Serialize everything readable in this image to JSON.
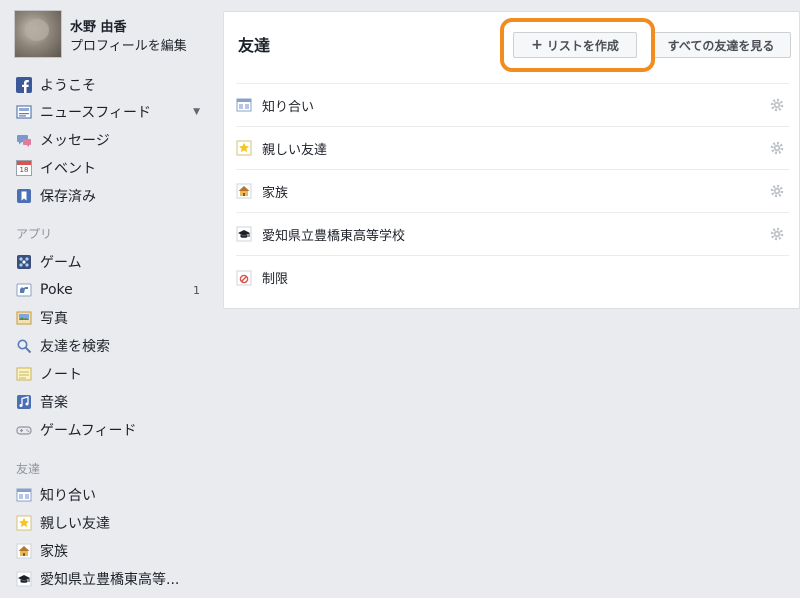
{
  "profile": {
    "name": "水野 由香",
    "edit_link": "プロフィールを編集"
  },
  "nav": {
    "items": [
      {
        "label": "ようこそ",
        "icon": "facebook-icon"
      },
      {
        "label": "ニュースフィード",
        "icon": "newsfeed-icon"
      },
      {
        "label": "メッセージ",
        "icon": "messages-icon"
      },
      {
        "label": "イベント",
        "icon": "calendar-icon",
        "icon_text": "18"
      },
      {
        "label": "保存済み",
        "icon": "bookmark-icon"
      }
    ]
  },
  "apps": {
    "header": "アプリ",
    "items": [
      {
        "label": "ゲーム",
        "icon": "games-icon"
      },
      {
        "label": "Poke",
        "icon": "poke-icon",
        "count": "1"
      },
      {
        "label": "写真",
        "icon": "photos-icon"
      },
      {
        "label": "友達を検索",
        "icon": "search-icon"
      },
      {
        "label": "ノート",
        "icon": "notes-icon"
      },
      {
        "label": "音楽",
        "icon": "music-icon"
      },
      {
        "label": "ゲームフィード",
        "icon": "gamepad-icon"
      }
    ]
  },
  "friends_section": {
    "header": "友達",
    "items": [
      {
        "label": "知り合い",
        "icon": "acquaintances-icon"
      },
      {
        "label": "親しい友達",
        "icon": "star-icon"
      },
      {
        "label": "家族",
        "icon": "family-house-icon"
      },
      {
        "label": "愛知県立豊橋東高等...",
        "icon": "graduation-cap-icon"
      }
    ]
  },
  "main": {
    "title": "友達",
    "create_list_button": "リストを作成",
    "see_all_button": "すべての友達を見る",
    "lists": [
      {
        "label": "知り合い",
        "icon": "acquaintances-icon"
      },
      {
        "label": "親しい友達",
        "icon": "star-icon"
      },
      {
        "label": "家族",
        "icon": "family-house-icon"
      },
      {
        "label": "愛知県立豊橋東高等学校",
        "icon": "graduation-cap-icon"
      },
      {
        "label": "制限",
        "icon": "restricted-icon"
      }
    ]
  },
  "colors": {
    "highlight": "#f28c1e",
    "brand": "#3b5998",
    "background": "#e9ebee"
  }
}
